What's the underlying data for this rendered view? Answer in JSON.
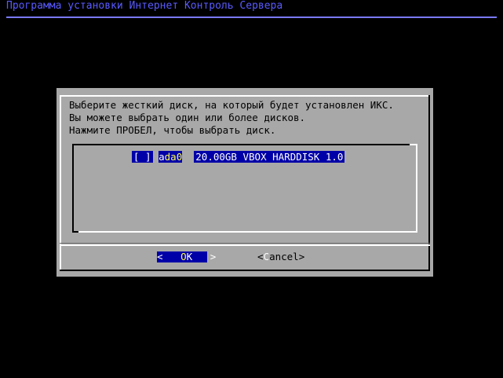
{
  "backtitle": "Программа установки Интернет Контроль Сервера",
  "dialog": {
    "prompt": "Выберите жесткий диск, на который будет установлен ИКС.\nВы можете выбрать один или более дисков.\nНажмите ПРОБЕЛ, чтобы выбрать диск.",
    "items": [
      {
        "checkbox": "[ ]",
        "tag_first": "a",
        "tag_rest": "da0",
        "description": "20.00GB VBOX HARDDISK 1.0",
        "checked": false,
        "selected": true
      }
    ],
    "buttons": {
      "ok": {
        "left_bracket": "<",
        "hot": "O",
        "rest": "K",
        "right_bracket": ">"
      },
      "cancel": {
        "left_bracket": "<",
        "hot": "C",
        "rest": "ancel",
        "right_bracket": ">"
      }
    }
  },
  "colors": {
    "background": "#000000",
    "backtitle": "#5a5aff",
    "dialog_bg": "#a8a8a8",
    "highlight_bg": "#0000a8",
    "highlight_hot": "#ffff55"
  }
}
